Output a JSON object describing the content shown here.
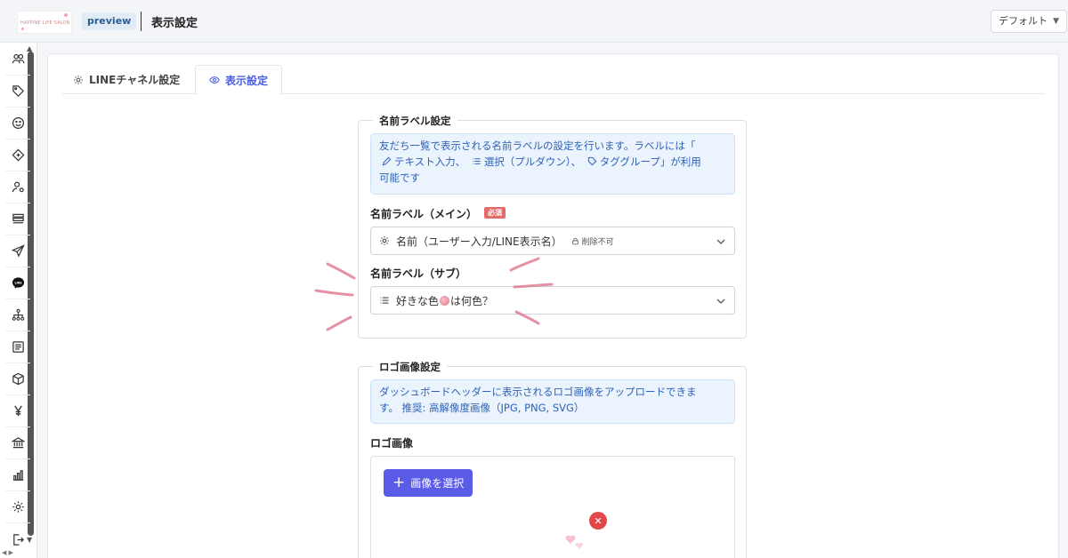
{
  "header": {
    "logo_text": "HAPPINE LIFE SALON",
    "env_badge": "preview",
    "page_title": "表示設定",
    "theme_select": "デフォルト"
  },
  "sidebar": {
    "items": [
      {
        "icon": "users-icon"
      },
      {
        "icon": "tag-icon"
      },
      {
        "icon": "smile-icon"
      },
      {
        "icon": "ticket-icon"
      },
      {
        "icon": "user-settings-icon"
      },
      {
        "icon": "list-bars-icon"
      },
      {
        "icon": "send-icon"
      },
      {
        "icon": "line-icon"
      },
      {
        "icon": "hierarchy-icon"
      },
      {
        "icon": "document-icon"
      },
      {
        "icon": "box-icon"
      },
      {
        "icon": "yen-icon"
      },
      {
        "icon": "bank-icon"
      },
      {
        "icon": "chart-icon"
      },
      {
        "icon": "gear-icon"
      },
      {
        "icon": "logout-icon"
      }
    ]
  },
  "tabs": [
    {
      "label": "LINEチャネル設定",
      "icon": "gear-icon"
    },
    {
      "label": "表示設定",
      "icon": "eye-icon",
      "active": true
    }
  ],
  "name_label_section": {
    "legend": "名前ラベル設定",
    "info_line1": "友だち一覧で表示される名前ラベルの設定を行います。ラベルには「",
    "info_text_input": "テキスト入力、",
    "info_select": "選択（プルダウン）、",
    "info_tag_group": "タググループ」が利用",
    "info_line3": "可能です",
    "main_label": "名前ラベル（メイン）",
    "required_badge": "必須",
    "main_value": "名前（ユーザー入力/LINE表示名）",
    "main_lock_note": "削除不可",
    "sub_label": "名前ラベル（サブ）",
    "sub_value_before": "好きな色",
    "sub_value_after": "は何色？"
  },
  "logo_section": {
    "legend": "ロゴ画像設定",
    "info_line1": "ダッシュボードヘッダーに表示されるロゴ画像をアップロードできま",
    "info_line2": "す。 推奨: 高解像度画像（JPG, PNG, SVG）",
    "field_label": "ロゴ画像",
    "upload_button": "画像を選択",
    "remove_symbol": "✕"
  },
  "colors": {
    "accent": "#5a5ce8",
    "tab_active": "#4a5fe0",
    "info_text": "#2e62b8",
    "info_bg": "#ebf3fd",
    "required": "#e56b6b",
    "remove": "#e24848",
    "annotation": "#e07f95"
  }
}
